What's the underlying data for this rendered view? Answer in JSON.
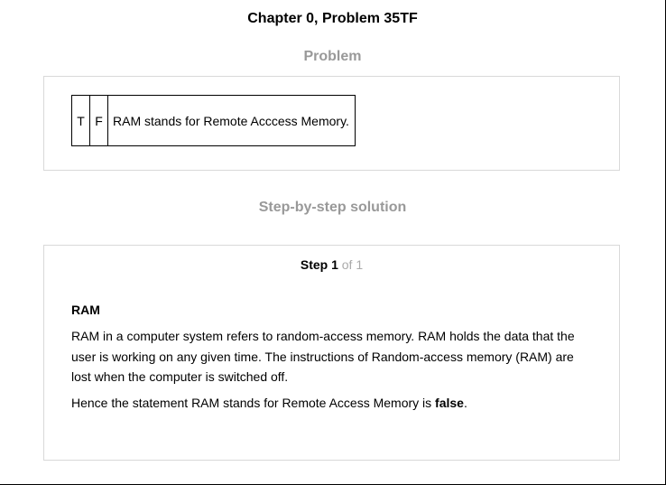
{
  "page": {
    "title": "Chapter 0, Problem 35TF"
  },
  "problem": {
    "heading": "Problem",
    "true_label": "T",
    "false_label": "F",
    "statement": "RAM stands for Remote Acccess Memory."
  },
  "solution": {
    "heading": "Step-by-step solution",
    "step_word": "Step 1",
    "step_of": "of 1",
    "subheading": "RAM",
    "paragraph_1": "RAM in a computer system refers to random-access memory. RAM holds the data that the user is working on any given time. The instructions of Random-access memory (RAM) are lost when the computer is switched off.",
    "paragraph_2_prefix": "Hence the statement RAM stands for Remote Access Memory is ",
    "paragraph_2_bold": "false",
    "paragraph_2_suffix": "."
  }
}
